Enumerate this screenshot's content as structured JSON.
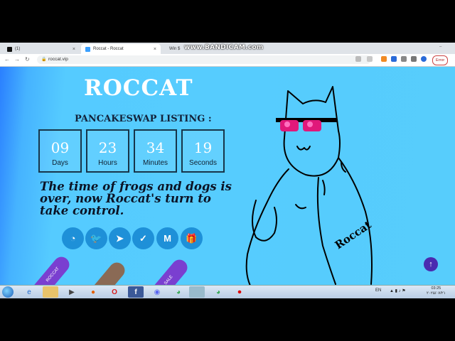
{
  "browser": {
    "tabs": [
      {
        "label": "(1)",
        "icon": "x-twitter-icon"
      },
      {
        "label": "Roccat - Roccat",
        "icon": "roccat-favicon-icon"
      },
      {
        "label": "Win $",
        "icon": "globe-icon"
      }
    ],
    "watermark": "www.BANDICAM.com",
    "url": "roccat.vip",
    "error_label": "Error"
  },
  "page": {
    "logo": "ROCCAT",
    "listing_title": "PANCAKESWAP LISTING :",
    "countdown": [
      {
        "value": "09",
        "label": "Days"
      },
      {
        "value": "23",
        "label": "Hours"
      },
      {
        "value": "34",
        "label": "Minutes"
      },
      {
        "value": "19",
        "label": "Seconds"
      }
    ],
    "tagline": "The time of frogs and dogs is over, now Roccat's turn to take control.",
    "social_icons": [
      "coinmarketcap-icon",
      "twitter-icon",
      "telegram-icon",
      "chart-icon",
      "medium-icon",
      "gift-icon"
    ],
    "social_glyphs": [
      "◔",
      "🐦",
      "➤",
      "✓",
      "M",
      "🎁"
    ],
    "stick_labels": [
      "ROCCAT",
      "",
      "SALE"
    ],
    "cat_text": "Roccat"
  },
  "taskbar": {
    "lang": "EN",
    "time": "03:25",
    "date": "۲۰۲۵/۰۷/۲۱"
  },
  "colors": {
    "page_bg": "#57cdfc",
    "countdown_border": "#17354a",
    "social_bg": "#1e90d8",
    "scroll_top": "#4a2bb0"
  }
}
